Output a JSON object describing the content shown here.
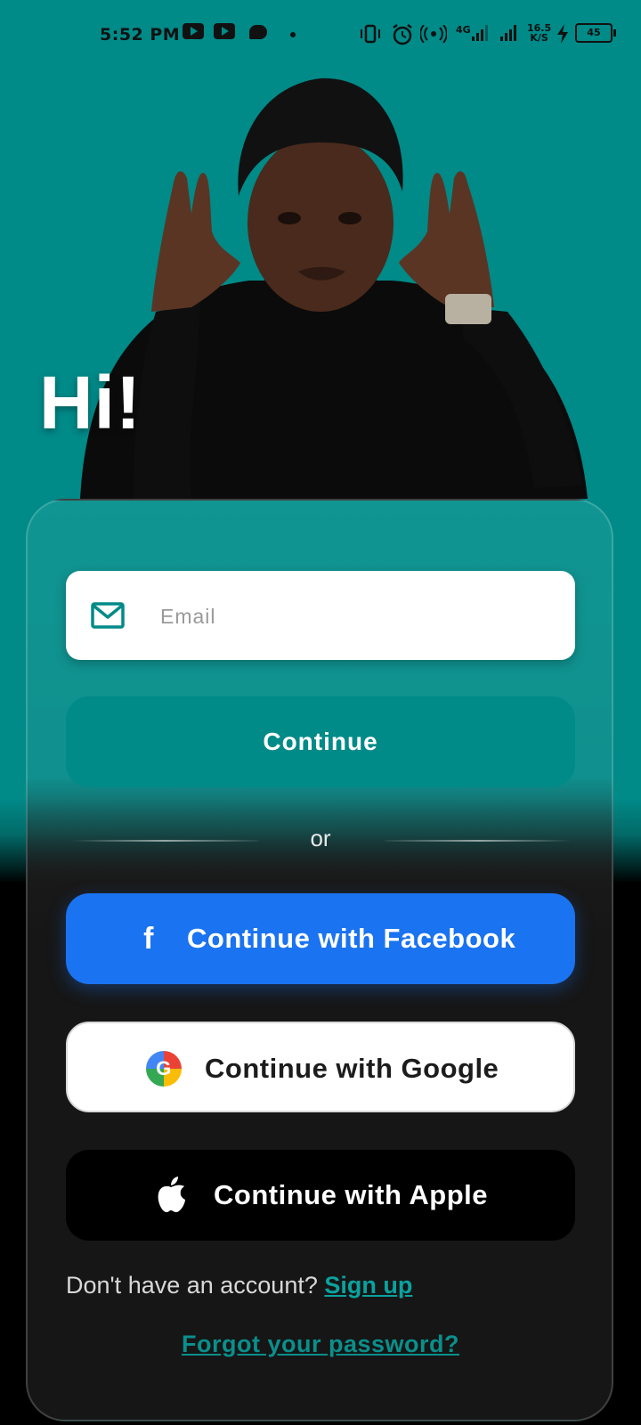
{
  "status_bar": {
    "time": "5:52 PM",
    "network_type": "4G",
    "data_speed_top": "16.5",
    "data_speed_bottom": "K/S",
    "battery_level": "45"
  },
  "hero": {
    "greeting": "Hi!"
  },
  "login": {
    "email_placeholder": "Email",
    "email_value": "",
    "continue_label": "Continue",
    "divider_label": "or",
    "facebook_label": "Continue with Facebook",
    "facebook_icon": "facebook-icon",
    "google_label": "Continue with Google",
    "google_icon": "google-icon",
    "apple_label": "Continue with Apple",
    "apple_icon": "apple-icon",
    "signup_prompt": "Don't have an account?",
    "signup_link": "Sign up",
    "forgot_link": "Forgot your password?"
  },
  "colors": {
    "accent": "#008a88",
    "facebook": "#1a73f0",
    "link": "#0aa29f",
    "card_dark": "#161616"
  }
}
